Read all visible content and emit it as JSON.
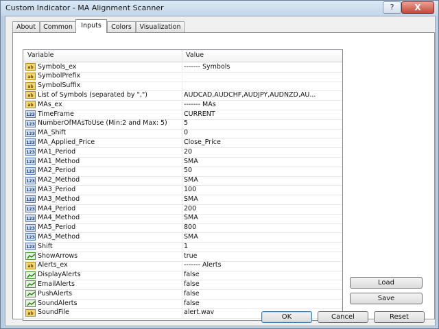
{
  "window": {
    "title": "Custom Indicator - MA Alignment Scanner",
    "help_label": "?",
    "close_label": "X"
  },
  "tabs": [
    {
      "label": "About"
    },
    {
      "label": "Common"
    },
    {
      "label": "Inputs",
      "active": true
    },
    {
      "label": "Colors"
    },
    {
      "label": "Visualization"
    }
  ],
  "grid": {
    "headers": {
      "variable": "Variable",
      "value": "Value"
    },
    "rows": [
      {
        "icon": "string-icon",
        "variable": "Symbols_ex",
        "value": "------- Symbols"
      },
      {
        "icon": "string-icon",
        "variable": "SymbolPrefix",
        "value": ""
      },
      {
        "icon": "string-icon",
        "variable": "SymbolSuffix",
        "value": ""
      },
      {
        "icon": "string-icon",
        "variable": "List of Symbols (separated by \",\")",
        "value": "AUDCAD,AUDCHF,AUDJPY,AUDNZD,AU..."
      },
      {
        "icon": "string-icon",
        "variable": "MAs_ex",
        "value": "------- MAs"
      },
      {
        "icon": "number-icon",
        "variable": "TimeFrame",
        "value": "CURRENT"
      },
      {
        "icon": "number-icon",
        "variable": "NumberOfMAsToUse (Min:2 and Max: 5)",
        "value": "5"
      },
      {
        "icon": "number-icon",
        "variable": "MA_Shift",
        "value": "0"
      },
      {
        "icon": "number-icon",
        "variable": "MA_Applied_Price",
        "value": "Close_Price"
      },
      {
        "icon": "number-icon",
        "variable": "MA1_Period",
        "value": "20"
      },
      {
        "icon": "number-icon",
        "variable": "MA1_Method",
        "value": "SMA"
      },
      {
        "icon": "number-icon",
        "variable": "MA2_Period",
        "value": "50"
      },
      {
        "icon": "number-icon",
        "variable": "MA2_Method",
        "value": "SMA"
      },
      {
        "icon": "number-icon",
        "variable": "MA3_Period",
        "value": "100"
      },
      {
        "icon": "number-icon",
        "variable": "MA3_Method",
        "value": "SMA"
      },
      {
        "icon": "number-icon",
        "variable": "MA4_Period",
        "value": "200"
      },
      {
        "icon": "number-icon",
        "variable": "MA4_Method",
        "value": "SMA"
      },
      {
        "icon": "number-icon",
        "variable": "MA5_Period",
        "value": "800"
      },
      {
        "icon": "number-icon",
        "variable": "MA5_Method",
        "value": "SMA"
      },
      {
        "icon": "number-icon",
        "variable": "Shift",
        "value": "1"
      },
      {
        "icon": "bool-icon",
        "variable": "ShowArrows",
        "value": "true"
      },
      {
        "icon": "string-icon",
        "variable": "Alerts_ex",
        "value": "------- Alerts"
      },
      {
        "icon": "bool-icon",
        "variable": "DisplayAlerts",
        "value": "false"
      },
      {
        "icon": "bool-icon",
        "variable": "EmailAlerts",
        "value": "false"
      },
      {
        "icon": "bool-icon",
        "variable": "PushAlerts",
        "value": "false"
      },
      {
        "icon": "bool-icon",
        "variable": "SoundAlerts",
        "value": "false"
      },
      {
        "icon": "string-icon",
        "variable": "SoundFile",
        "value": "alert.wav"
      }
    ]
  },
  "side_buttons": {
    "load": "Load",
    "save": "Save"
  },
  "footer_buttons": {
    "ok": "OK",
    "cancel": "Cancel",
    "reset": "Reset"
  }
}
